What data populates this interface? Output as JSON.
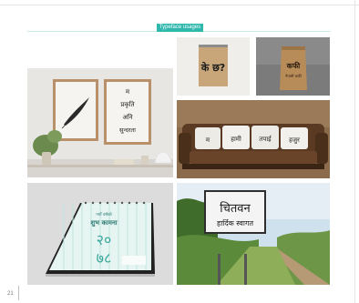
{
  "header": {
    "tag_label": "Typeface usages"
  },
  "colors": {
    "accent": "#2fb8ac",
    "rule": "#c9ecea"
  },
  "photos": {
    "framed_prints": {
      "poster_lines": [
        "म",
        "प्रकृति",
        "अनि",
        "सुन्दरता"
      ]
    },
    "notebook": {
      "text": "के छ?"
    },
    "coffee_bag": {
      "text": "कफी",
      "subtext": "नेपाली कफी"
    },
    "sofa": {
      "pillow_texts": [
        "म",
        "हामी",
        "तपाई",
        "हजुर"
      ]
    },
    "calendar": {
      "small_text": "नयाँ वर्षको",
      "big_text": "शुभ कामना",
      "year_top": "२०",
      "year_bottom": "७८"
    },
    "road_sign": {
      "line1": "चितवन",
      "line2": "हार्दिक स्वागत"
    }
  },
  "footer": {
    "page_number": "21"
  }
}
